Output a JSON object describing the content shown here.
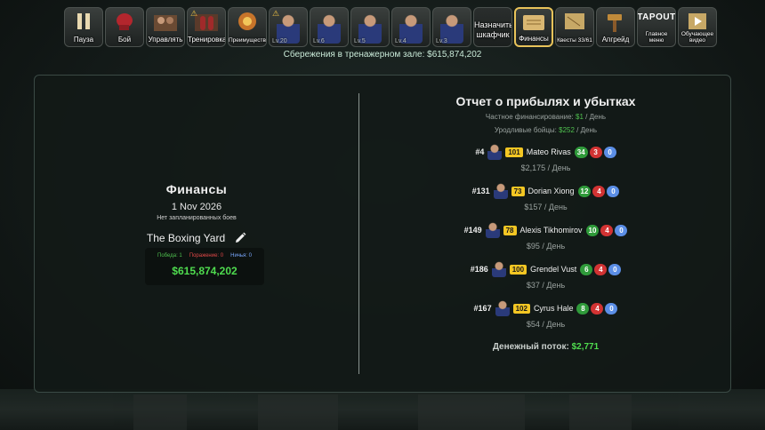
{
  "toolbar": [
    {
      "name": "pause-button",
      "label": "Пауза",
      "icon": "pause-icon"
    },
    {
      "name": "fight-button",
      "label": "Бой",
      "icon": "boxing-glove-icon"
    },
    {
      "name": "manage-button",
      "label": "Управлять",
      "icon": "manage-icon"
    },
    {
      "name": "training-button",
      "label": "Тренировка",
      "icon": "training-icon",
      "warning": true
    },
    {
      "name": "perks-button",
      "label": "Преимущества",
      "icon": "perk-icon"
    },
    {
      "name": "fighter-1-button",
      "lv": "Lv.20",
      "warning": true
    },
    {
      "name": "fighter-2-button",
      "lv": "Lv.6"
    },
    {
      "name": "fighter-3-button",
      "lv": "Lv.5"
    },
    {
      "name": "fighter-4-button",
      "lv": "Lv.4"
    },
    {
      "name": "fighter-5-button",
      "lv": "Lv.3"
    },
    {
      "name": "assign-locker-button",
      "label": "Назначить шкафчик",
      "plain": true
    },
    {
      "name": "finances-button",
      "label": "Финансы",
      "icon": "scroll-icon",
      "active": true
    },
    {
      "name": "quests-button",
      "label": "Квесты 33/61",
      "icon": "map-icon"
    },
    {
      "name": "upgrade-button",
      "label": "Апгрейд",
      "icon": "hammer-icon"
    },
    {
      "name": "main-menu-button",
      "label": "Главное меню",
      "icon": "tapout-logo-icon",
      "logo": "TAPOUT"
    },
    {
      "name": "tutorial-video-button",
      "label": "Обучающее видео",
      "icon": "play-icon"
    }
  ],
  "savings": "Сбережения в тренажерном зале: $615,874,202",
  "finances": {
    "title": "Финансы",
    "date": "1 Nov 2026",
    "no_matches": "Нет запланированных боев",
    "gym_name": "The Boxing Yard",
    "wins": "Победа: 1",
    "losses": "Поражение: 0",
    "draws": "Ничья: 0",
    "money": "$615,874,202"
  },
  "pnl": {
    "title": "Отчет о прибылях и убытках",
    "private_funding_label": "Частное финансирование:",
    "private_funding_value": "$1",
    "private_funding_unit": "/ День",
    "homegrown_label": "Уродливые бойцы:",
    "homegrown_value": "$252",
    "homegrown_unit": "/ День",
    "fighters": [
      {
        "rank": "#4",
        "ovr": "101",
        "name": "Mateo Rivas",
        "w": "34",
        "l": "3",
        "d": "0",
        "pay": "$2,175 / День"
      },
      {
        "rank": "#131",
        "ovr": "73",
        "name": "Dorian Xiong",
        "w": "12",
        "l": "4",
        "d": "0",
        "pay": "$157 / День"
      },
      {
        "rank": "#149",
        "ovr": "78",
        "name": "Alexis Tikhomirov",
        "w": "10",
        "l": "4",
        "d": "0",
        "pay": "$95 / День"
      },
      {
        "rank": "#186",
        "ovr": "100",
        "name": "Grendel Vust",
        "w": "6",
        "l": "4",
        "d": "0",
        "pay": "$37 / День"
      },
      {
        "rank": "#167",
        "ovr": "102",
        "name": "Cyrus Hale",
        "w": "8",
        "l": "4",
        "d": "0",
        "pay": "$54 / День"
      }
    ],
    "cashflow_label": "Денежный поток:",
    "cashflow_value": "$2,771"
  },
  "colors": {
    "accent_gold": "#e8c35a",
    "positive": "#4fdc4f",
    "win": "#2f9a3a",
    "loss": "#d23333",
    "draw": "#5b8ee6",
    "ovr_badge": "#f3c623"
  }
}
